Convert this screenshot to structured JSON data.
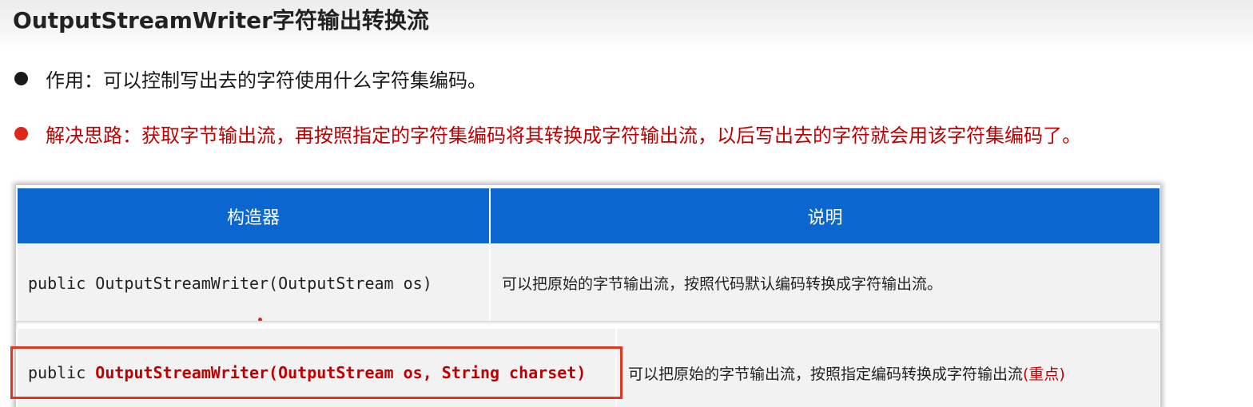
{
  "title": "OutputStreamWriter字符输出转换流",
  "bullets": [
    {
      "text": "作用：可以控制写出去的字符使用什么字符集编码。"
    },
    {
      "text": "解决思路：获取字节输出流，再按照指定的字符集编码将其转换成字符输出流，以后写出去的字符就会用该字符集编码了。"
    }
  ],
  "table": {
    "headers": [
      "构造器",
      "说明"
    ],
    "rows": [
      {
        "constructor_prefix": "public ",
        "constructor_signature": "OutputStreamWriter(OutputStream os)",
        "description": "可以把原始的字节输出流，按照代码默认编码转换成字符输出流。",
        "description_suffix": ""
      },
      {
        "constructor_prefix": "public ",
        "constructor_signature": "OutputStreamWriter(OutputStream os, String charset)",
        "description": "可以把原始的字节输出流，按照指定编码转换成字符输出流",
        "description_suffix": "(重点)"
      }
    ]
  },
  "colors": {
    "header_bg": "#0b66cf",
    "highlight_red": "#c00000",
    "box_border": "#e0371f"
  }
}
